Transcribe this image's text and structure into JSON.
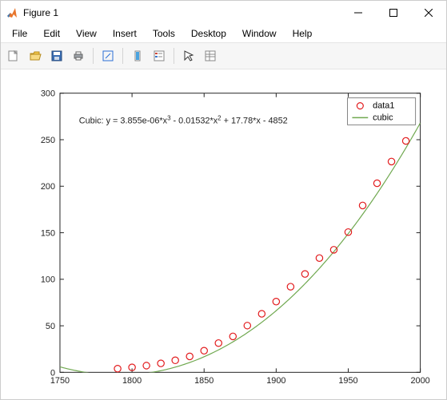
{
  "window": {
    "title": "Figure 1"
  },
  "menubar": {
    "items": [
      "File",
      "Edit",
      "View",
      "Insert",
      "Tools",
      "Desktop",
      "Window",
      "Help"
    ]
  },
  "legend": {
    "items": [
      {
        "label": "data1",
        "type": "marker"
      },
      {
        "label": "cubic",
        "type": "line"
      }
    ]
  },
  "annotation": {
    "prefix": "Cubic:  y = 3.855e-06*x",
    "sup1": "3",
    "mid1": " - 0.01532*x",
    "sup2": "2",
    "mid2": " + 17.78*x - 4852"
  },
  "axes": {
    "xticks": [
      "1750",
      "1800",
      "1850",
      "1900",
      "1950",
      "2000"
    ],
    "yticks": [
      "0",
      "50",
      "100",
      "150",
      "200",
      "250",
      "300"
    ]
  },
  "colors": {
    "data_marker": "#e21a1c",
    "fit_line": "#6fa84f",
    "axes": "#222222"
  },
  "chart_data": {
    "type": "scatter+line",
    "xlabel": "",
    "ylabel": "",
    "xlim": [
      1750,
      2000
    ],
    "ylim": [
      0,
      300
    ],
    "fit_equation": "y = 3.855e-06*x^3 - 0.01532*x^2 + 17.78*x - 4852",
    "series": [
      {
        "name": "data1",
        "type": "scatter",
        "x": [
          1790,
          1800,
          1810,
          1820,
          1830,
          1840,
          1850,
          1860,
          1870,
          1880,
          1890,
          1900,
          1910,
          1920,
          1930,
          1940,
          1950,
          1960,
          1970,
          1980,
          1990
        ],
        "y": [
          3.9,
          5.3,
          7.2,
          9.6,
          12.9,
          17.1,
          23.2,
          31.4,
          38.6,
          50.2,
          62.9,
          76.0,
          92.0,
          105.7,
          122.8,
          131.7,
          150.7,
          179.3,
          203.2,
          226.5,
          248.7
        ]
      },
      {
        "name": "cubic",
        "type": "line",
        "coefficients": {
          "a": 3.855e-06,
          "b": -0.01532,
          "c": 17.78,
          "d": -4852
        }
      }
    ]
  }
}
